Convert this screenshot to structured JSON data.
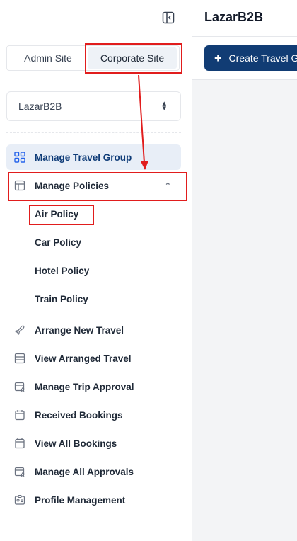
{
  "app": {
    "title": "LazarB2B"
  },
  "site_tabs": [
    {
      "label": "Admin Site",
      "selected": false
    },
    {
      "label": "Corporate Site",
      "selected": true
    }
  ],
  "company_select": {
    "value": "LazarB2B"
  },
  "nav": {
    "manage_travel_group": "Manage Travel Group",
    "manage_policies": "Manage Policies",
    "policies_sub": [
      "Air Policy",
      "Car Policy",
      "Hotel Policy",
      "Train Policy"
    ],
    "arrange_new_travel": "Arrange New Travel",
    "view_arranged_travel": "View Arranged Travel",
    "manage_trip_approval": "Manage Trip Approval",
    "received_bookings": "Received Bookings",
    "view_all_bookings": "View All Bookings",
    "manage_all_approvals": "Manage All Approvals",
    "profile_management": "Profile Management"
  },
  "toolbar": {
    "create_label": "Create Travel Group"
  },
  "colors": {
    "accent": "#113c74",
    "annotation": "#e11d1d",
    "active_bg": "#e8eef7"
  },
  "icons": [
    "sidebar-collapse-icon",
    "grid-icon",
    "table-icon",
    "chevron-up-icon",
    "plane-icon",
    "list-icon",
    "calendar-star-icon",
    "calendar-icon",
    "id-card-icon",
    "plus-icon"
  ]
}
